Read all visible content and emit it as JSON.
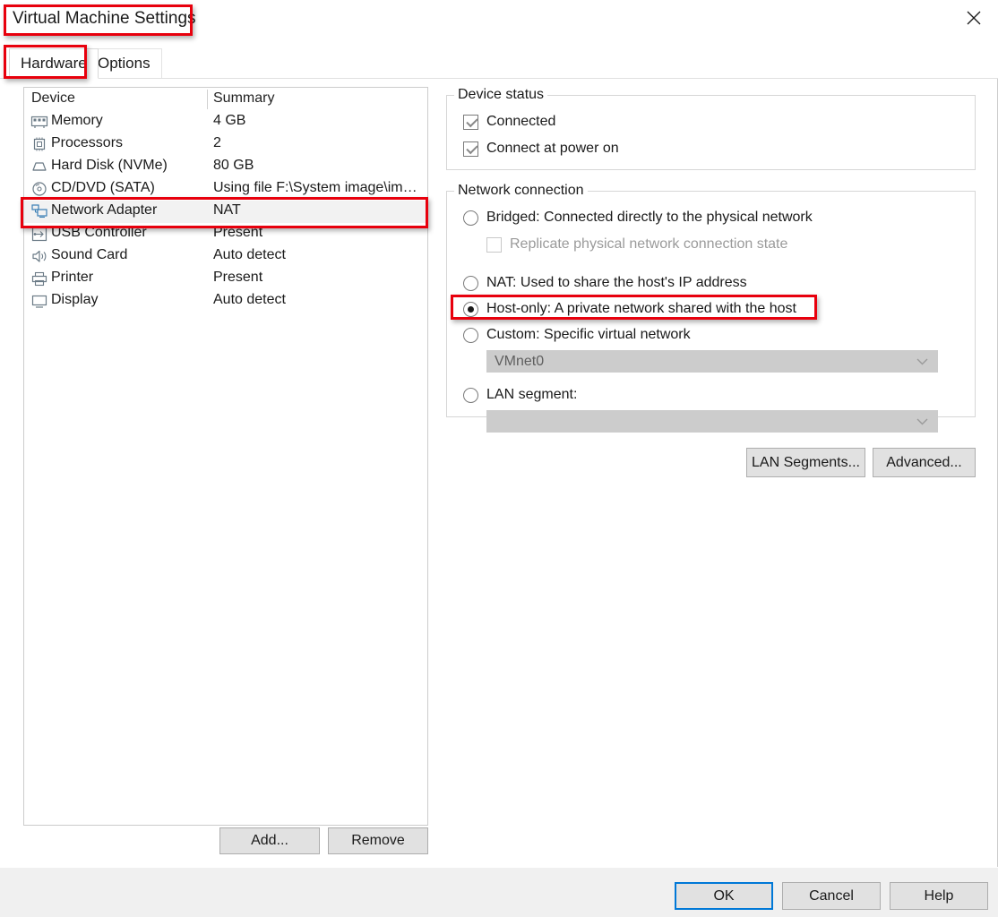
{
  "window": {
    "title": "Virtual Machine Settings",
    "close_icon": "close-icon"
  },
  "tabs": [
    {
      "label": "Hardware",
      "active": true
    },
    {
      "label": "Options",
      "active": false
    }
  ],
  "device_list": {
    "columns": [
      "Device",
      "Summary"
    ],
    "rows": [
      {
        "icon": "memory-icon",
        "device": "Memory",
        "summary": "4 GB",
        "selected": false
      },
      {
        "icon": "processor-icon",
        "device": "Processors",
        "summary": "2",
        "selected": false
      },
      {
        "icon": "hard-disk-icon",
        "device": "Hard Disk (NVMe)",
        "summary": "80 GB",
        "selected": false
      },
      {
        "icon": "cd-dvd-icon",
        "device": "CD/DVD (SATA)",
        "summary": "Using file F:\\System image\\im…",
        "selected": false
      },
      {
        "icon": "network-adapter-icon",
        "device": "Network Adapter",
        "summary": "NAT",
        "selected": true
      },
      {
        "icon": "usb-controller-icon",
        "device": "USB Controller",
        "summary": "Present",
        "selected": false
      },
      {
        "icon": "sound-card-icon",
        "device": "Sound Card",
        "summary": "Auto detect",
        "selected": false
      },
      {
        "icon": "printer-icon",
        "device": "Printer",
        "summary": "Present",
        "selected": false
      },
      {
        "icon": "display-icon",
        "device": "Display",
        "summary": "Auto detect",
        "selected": false
      }
    ],
    "add_label": "Add...",
    "remove_label": "Remove"
  },
  "device_status": {
    "title": "Device status",
    "connected": {
      "label": "Connected",
      "checked": true
    },
    "connect_at_power_on": {
      "label": "Connect at power on",
      "checked": true
    }
  },
  "network_connection": {
    "title": "Network connection",
    "options": [
      {
        "label": "Bridged: Connected directly to the physical network",
        "selected": false
      },
      {
        "label": "NAT: Used to share the host's IP address",
        "selected": false
      },
      {
        "label": "Host-only: A private network shared with the host",
        "selected": true
      },
      {
        "label": "Custom: Specific virtual network",
        "selected": false
      },
      {
        "label": "LAN segment:",
        "selected": false
      }
    ],
    "replicate": {
      "label": "Replicate physical network connection state",
      "checked": false,
      "disabled": true
    },
    "custom_network_value": "VMnet0",
    "lan_segment_value": "",
    "lan_segments_label": "LAN Segments...",
    "advanced_label": "Advanced..."
  },
  "footer": {
    "ok_label": "OK",
    "cancel_label": "Cancel",
    "help_label": "Help"
  },
  "annotations": {
    "accent_color": "#e8000d",
    "highlighted": [
      "window-title",
      "hardware-tab",
      "network-adapter-row",
      "host-only-option"
    ]
  }
}
